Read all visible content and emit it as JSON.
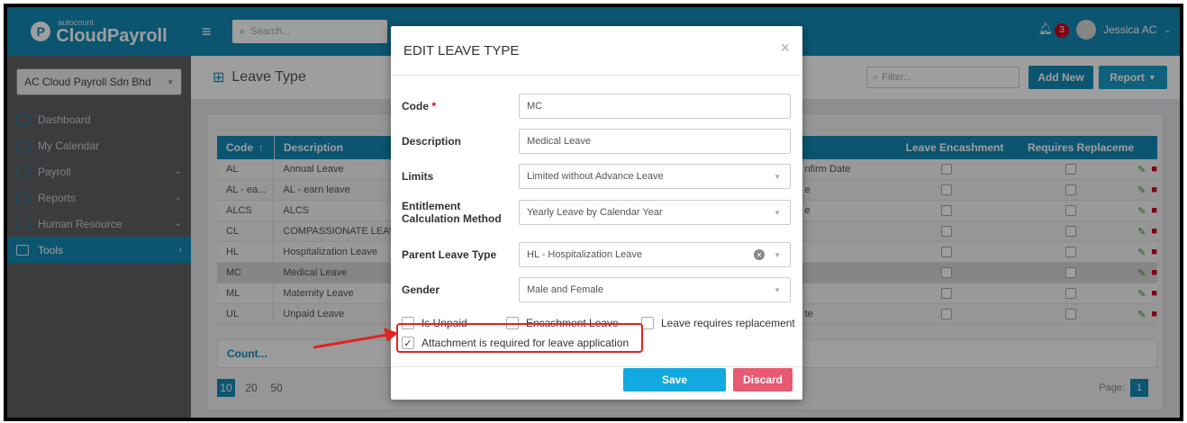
{
  "app": {
    "logo_small": "autocount",
    "logo_big": "CloudPayroll",
    "logo_letter": "P"
  },
  "company": "AC Cloud Payroll Sdn Bhd",
  "sidebar": {
    "items": [
      {
        "label": "Dashboard",
        "chevron": ""
      },
      {
        "label": "My Calendar",
        "chevron": ""
      },
      {
        "label": "Payroll",
        "chevron": "⌄"
      },
      {
        "label": "Reports",
        "chevron": "⌄"
      },
      {
        "label": "Human Resource",
        "chevron": "⌄"
      },
      {
        "label": "Tools",
        "chevron": "›"
      }
    ]
  },
  "topbar": {
    "search_placeholder": "Search...",
    "notifications": "3",
    "user": "Jessica AC"
  },
  "page": {
    "title": "Leave Type",
    "filter_placeholder": "Filter...",
    "add_new": "Add New",
    "report": "Report"
  },
  "table": {
    "headers": {
      "code": "Code",
      "description": "Description",
      "encashment": "Leave Encashment",
      "replacement": "Requires Replaceme"
    },
    "rows": [
      {
        "code": "AL",
        "desc": "Annual Leave",
        "extra": "nfirm Date"
      },
      {
        "code": "AL - ea...",
        "desc": "AL - earn leave",
        "extra": "e"
      },
      {
        "code": "ALCS",
        "desc": "ALCS",
        "extra": "e"
      },
      {
        "code": "CL",
        "desc": "COMPASSIONATE LEAVE",
        "extra": ""
      },
      {
        "code": "HL",
        "desc": "Hospitalization Leave",
        "extra": ""
      },
      {
        "code": "MC",
        "desc": "Medical Leave",
        "extra": ""
      },
      {
        "code": "ML",
        "desc": "Maternity Leave",
        "extra": ""
      },
      {
        "code": "UL",
        "desc": "Unpaid Leave",
        "extra": "te"
      }
    ],
    "count": "Count...",
    "page_sizes": [
      "10",
      "20",
      "50"
    ],
    "page_label": "Page:",
    "page_num": "1"
  },
  "modal": {
    "title": "EDIT LEAVE TYPE",
    "close": "×",
    "code_label": "Code",
    "code_value": "MC",
    "description_label": "Description",
    "description_value": "Medical Leave",
    "limits_label": "Limits",
    "limits_value": "Limited without Advance Leave",
    "entitlement_label": "Entitlement Calculation Method",
    "entitlement_value": "Yearly Leave by Calendar Year",
    "parent_label": "Parent Leave Type",
    "parent_value": "HL - Hospitalization Leave",
    "gender_label": "Gender",
    "gender_value": "Male and Female",
    "is_unpaid": "Is Unpaid",
    "encashment": "Encashment Leave",
    "replacement": "Leave requires replacement",
    "attachment": "Attachment is required for leave application",
    "save": "Save",
    "discard": "Discard"
  },
  "colors": {
    "brand": "#1289b7",
    "highlight": "#e02424",
    "discard": "#e85a72"
  }
}
